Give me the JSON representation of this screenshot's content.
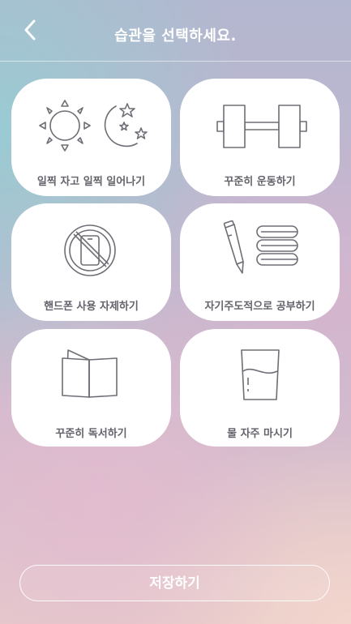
{
  "header": {
    "title": "습관을 선택하세요."
  },
  "habits": [
    {
      "label": "일찍 자고 일찍 일어나기",
      "icon": "sun-moon-icon"
    },
    {
      "label": "꾸준히 운동하기",
      "icon": "dumbbell-icon"
    },
    {
      "label": "핸드폰 사용 자제하기",
      "icon": "no-phone-icon"
    },
    {
      "label": "자기주도적으로 공부하기",
      "icon": "pen-books-icon"
    },
    {
      "label": "꾸준히 독서하기",
      "icon": "book-icon"
    },
    {
      "label": "물 자주 마시기",
      "icon": "water-glass-icon"
    }
  ],
  "footer": {
    "save_label": "저장하기"
  },
  "colors": {
    "icon_stroke": "#6e6e76",
    "label_text": "#63636b"
  }
}
